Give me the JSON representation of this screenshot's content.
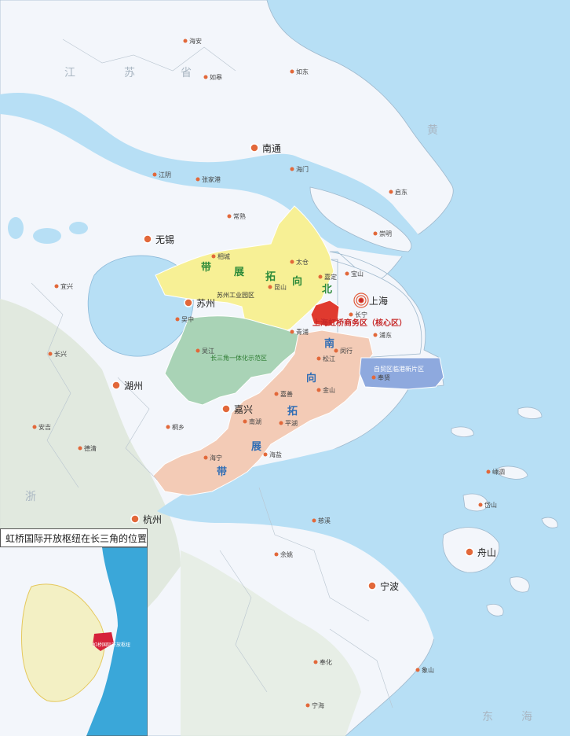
{
  "colors": {
    "sea": "#b7dff5",
    "land": "#f3f6fb",
    "hill": "#dfe8dc",
    "north_band": "#f7f095",
    "core_zone": "#e03a2f",
    "demo_zone": "#a9d3b6",
    "south_band": "#f3cbb6",
    "ftz": "#8ea9de",
    "city_dot": "#e2683a"
  },
  "labels": {
    "province_jiangsu": [
      "江",
      "苏",
      "省"
    ],
    "province_zhejiang": "浙",
    "sea_east": [
      "东",
      "海"
    ],
    "sea_yellow": "黄",
    "core_zone": "上海虹桥商务区（核心区）",
    "demo_zone": "长三角一体化示范区",
    "ftz": "自贸区临港新片区",
    "suzhou_park": "苏州工业园区",
    "north_band": [
      "北",
      "向",
      "拓",
      "展",
      "带"
    ],
    "south_band": [
      "南",
      "向",
      "拓",
      "展",
      "带"
    ]
  },
  "cities_major": [
    {
      "name": "上海",
      "icon": "capital-icon"
    },
    {
      "name": "南通"
    },
    {
      "name": "无锡"
    },
    {
      "name": "苏州"
    },
    {
      "name": "湖州"
    },
    {
      "name": "嘉兴"
    },
    {
      "name": "杭州"
    },
    {
      "name": "宁波"
    },
    {
      "name": "舟山"
    }
  ],
  "towns": [
    "海安",
    "如皋",
    "如东",
    "海门",
    "启东",
    "江阴",
    "张家港",
    "常熟",
    "太仓",
    "崇明",
    "相城",
    "嘉定",
    "宝山",
    "长宁",
    "闵行",
    "浦东",
    "昆山",
    "青浦",
    "松江",
    "吴中",
    "吴江",
    "嘉善",
    "金山",
    "奉贤",
    "宜兴",
    "长兴",
    "安吉",
    "桐乡",
    "平湖",
    "南湖",
    "海盐",
    "海宁",
    "德清",
    "嵊泗",
    "岱山",
    "慈溪",
    "余姚",
    "奉化",
    "象山",
    "宁海"
  ],
  "inset": {
    "title": "虹桥国际开放枢纽在长三角的位置",
    "marker_label": "虹桥国际开放枢纽"
  }
}
